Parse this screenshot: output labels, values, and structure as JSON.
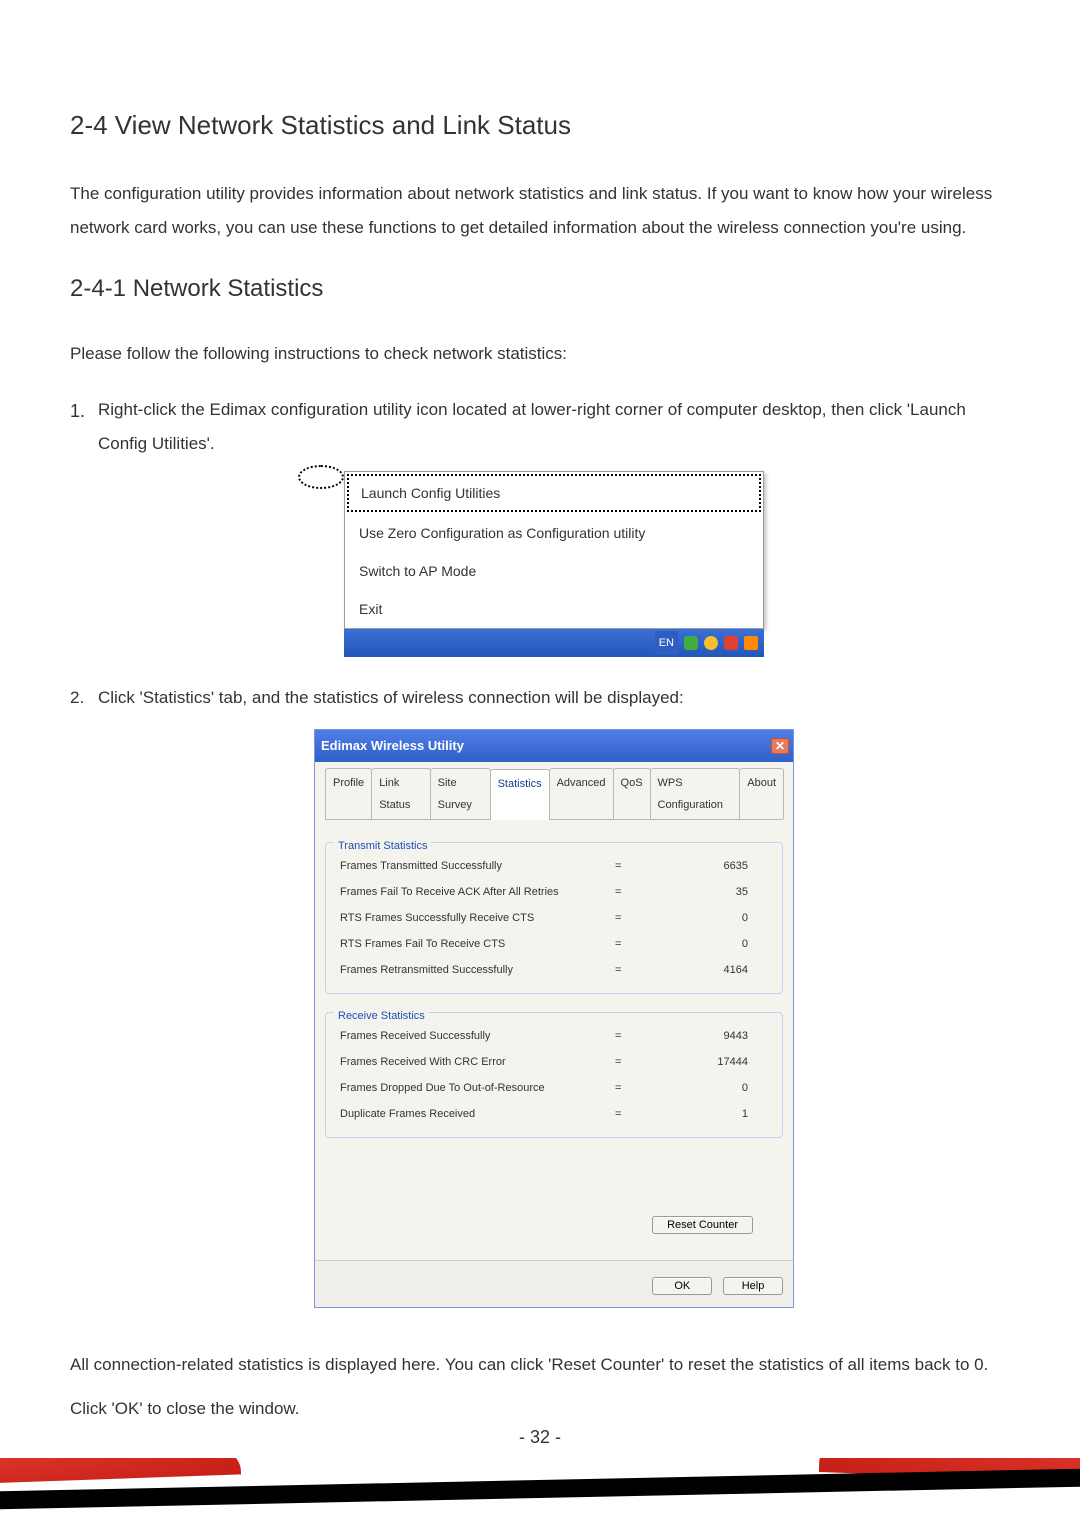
{
  "headings": {
    "h2": "2-4 View Network Statistics and Link Status",
    "h3": "2-4-1 Network Statistics"
  },
  "paragraphs": {
    "intro": "The configuration utility provides information about network statistics and link status. If you want to know how your wireless network card works, you can use these functions to get detailed information about the wireless connection you're using.",
    "follow": "Please follow the following instructions to check network statistics:",
    "after1": "All connection-related statistics is displayed here. You can click 'Reset Counter' to reset the statistics of all items back to 0.",
    "after2": "Click 'OK' to close the window."
  },
  "steps": {
    "s1_num": "1.",
    "s1": "Right-click the Edimax configuration utility icon located at lower-right corner of computer desktop, then click 'Launch Config Utilities'.",
    "s2_num": "2.",
    "s2": "Click 'Statistics' tab, and the statistics of wireless connection will be displayed:"
  },
  "context_menu": {
    "items": [
      "Launch Config Utilities",
      "Use Zero Configuration as Configuration utility",
      "Switch to AP Mode",
      "Exit"
    ],
    "lang": "EN"
  },
  "dialog": {
    "title": "Edimax Wireless Utility",
    "tabs": [
      "Profile",
      "Link Status",
      "Site Survey",
      "Statistics",
      "Advanced",
      "QoS",
      "WPS Configuration",
      "About"
    ],
    "active_tab": "Statistics",
    "groups": {
      "transmit": {
        "legend": "Transmit Statistics",
        "rows": [
          {
            "label": "Frames Transmitted Successfully",
            "value": "6635"
          },
          {
            "label": "Frames Fail To Receive ACK After All Retries",
            "value": "35"
          },
          {
            "label": "RTS Frames Successfully Receive CTS",
            "value": "0"
          },
          {
            "label": "RTS Frames Fail To Receive CTS",
            "value": "0"
          },
          {
            "label": "Frames Retransmitted Successfully",
            "value": "4164"
          }
        ]
      },
      "receive": {
        "legend": "Receive Statistics",
        "rows": [
          {
            "label": "Frames Received Successfully",
            "value": "9443"
          },
          {
            "label": "Frames Received With CRC Error",
            "value": "17444"
          },
          {
            "label": "Frames Dropped Due To Out-of-Resource",
            "value": "0"
          },
          {
            "label": "Duplicate Frames Received",
            "value": "1"
          }
        ]
      }
    },
    "buttons": {
      "reset": "Reset Counter",
      "ok": "OK",
      "help": "Help"
    }
  },
  "page_number": "- 32 -"
}
